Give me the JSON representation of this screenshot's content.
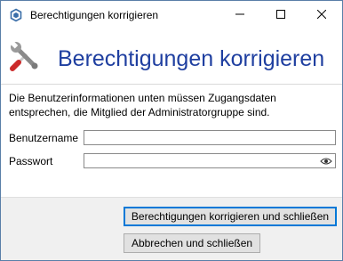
{
  "window": {
    "title": "Berechtigungen korrigieren",
    "controls": {
      "minimize_icon": "minimize-icon",
      "maximize_icon": "maximize-icon",
      "close_icon": "close-icon"
    }
  },
  "header": {
    "icon": "tools-icon",
    "title": "Berechtigungen korrigieren",
    "title_color": "#1f3fa0"
  },
  "description": "Die Benutzerinformationen unten müssen Zugangsdaten entsprechen, die Mitglied der Administratorgruppe sind.",
  "form": {
    "username": {
      "label": "Benutzername",
      "value": ""
    },
    "password": {
      "label": "Passwort",
      "value": "",
      "reveal_icon": "eye-icon"
    }
  },
  "buttons": {
    "fix_and_close": "Berechtigungen korrigieren und schließen",
    "cancel_and_close": "Abbrechen und schließen"
  },
  "colors": {
    "accent": "#0078d7",
    "footer_bg": "#f0f0f0"
  }
}
